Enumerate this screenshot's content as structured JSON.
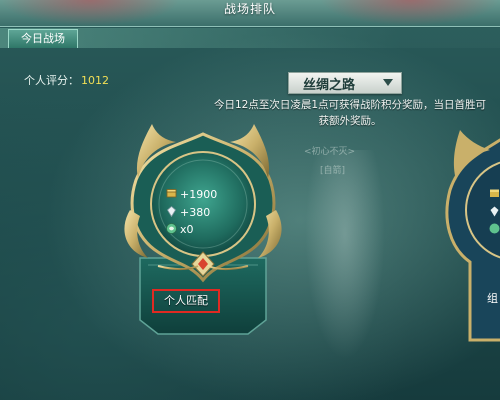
{
  "window": {
    "title": "战场排队"
  },
  "tabs": [
    {
      "label": "今日战场"
    }
  ],
  "score": {
    "label": "个人评分：",
    "value": "1012"
  },
  "route_select": {
    "selected": "丝绸之路"
  },
  "rules_text": "今日12点至次日凌晨1点可获得战阶积分奖励，当日首胜可获额外奖励。",
  "rewards": [
    {
      "icon": "coin-chest-icon",
      "value": "+1900"
    },
    {
      "icon": "crystal-icon",
      "value": "+380"
    },
    {
      "icon": "jade-orb-icon",
      "value": "x0"
    }
  ],
  "match_button": {
    "label": "个人匹配"
  },
  "right_card": {
    "label": "组"
  },
  "background": {
    "text_1": "<初心不灭>",
    "text_2": "[自箭]"
  },
  "colors": {
    "accent_gold": "#c9b06a",
    "score_yellow": "#f3df55",
    "highlight_red": "#e02a22"
  }
}
